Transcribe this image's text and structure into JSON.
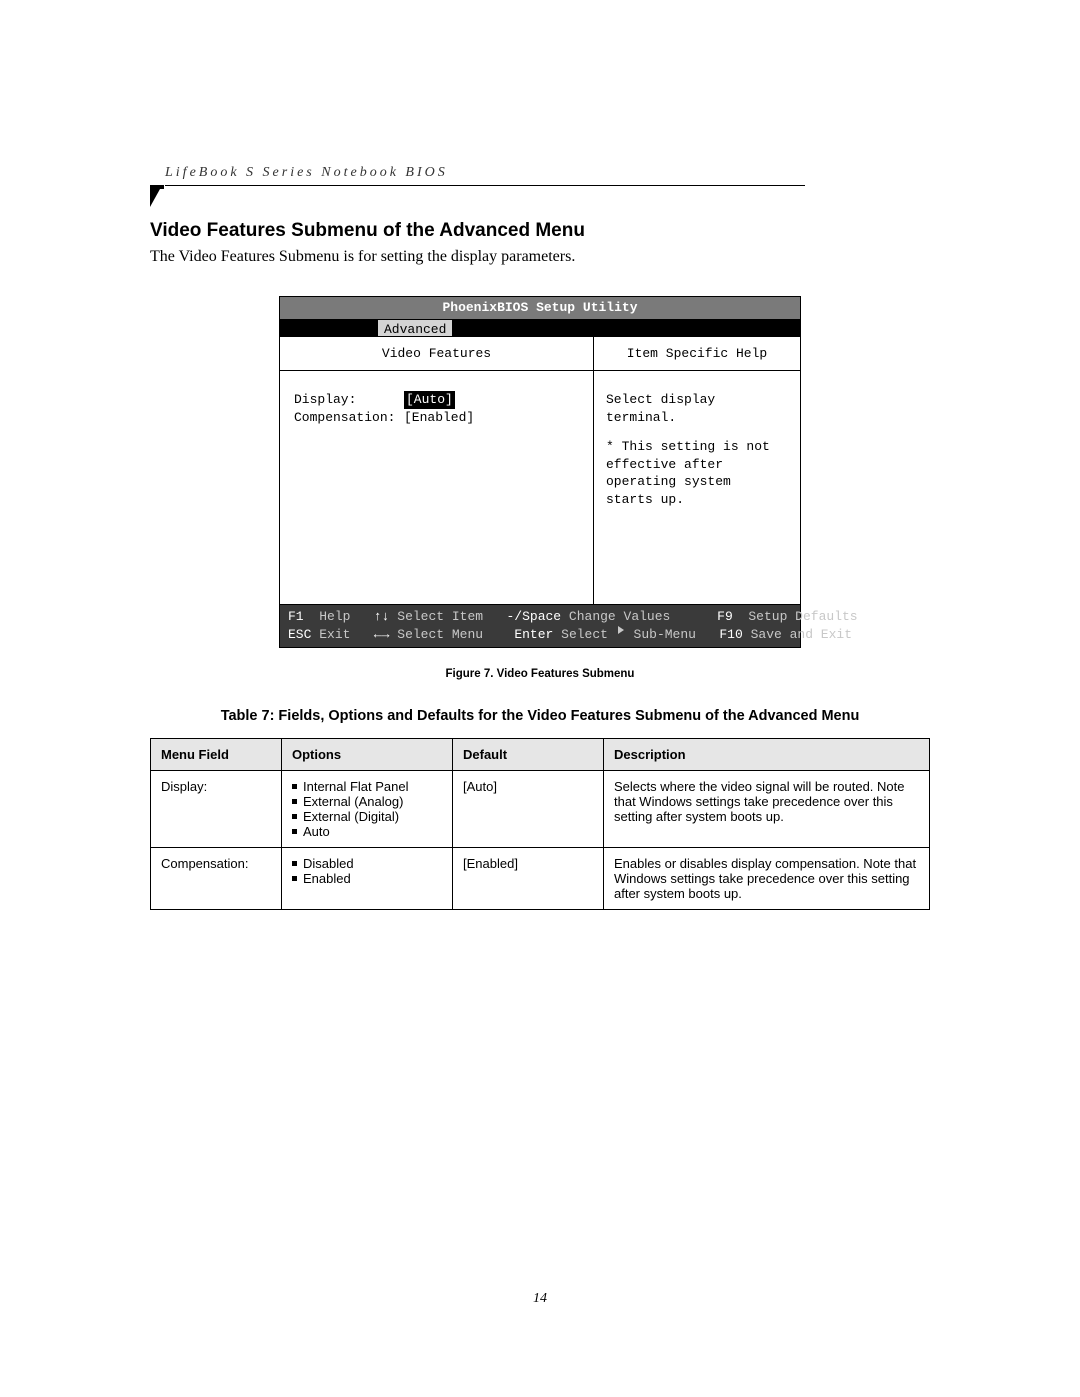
{
  "running_head": "LifeBook S Series Notebook BIOS",
  "page_number": "14",
  "section_title": "Video Features Submenu of the Advanced Menu",
  "intro_text": "The Video Features Submenu is for setting the display parameters.",
  "bios": {
    "title": "PhoenixBIOS Setup Utility",
    "tab": "Advanced",
    "left_col_title": "Video Features",
    "right_col_title": "Item Specific Help",
    "fields": {
      "display_label": "Display:",
      "display_value": "[Auto]",
      "compensation_label": "Compensation:",
      "compensation_value": "[Enabled]"
    },
    "help": {
      "line1": "Select display terminal.",
      "line2": "* This setting is not",
      "line3": "effective after",
      "line4": "operating system",
      "line5": "starts up."
    },
    "footer": {
      "f1_key": "F1",
      "f1_label": "Help",
      "updown_key": "↑↓",
      "updown_label": "Select Item",
      "minusspace_key": "-/Space",
      "minusspace_label": "Change Values",
      "f9_key": "F9",
      "f9_label": "Setup Defaults",
      "esc_key": "ESC",
      "esc_label": "Exit",
      "leftright_key": "←→",
      "leftright_label": "Select Menu",
      "enter_key": "Enter",
      "enter_label": "Select ▶ Sub-Menu",
      "f10_key": "F10",
      "f10_label": "Save and Exit"
    }
  },
  "figure_caption": "Figure 7.  Video Features Submenu",
  "table_title": "Table 7: Fields, Options and Defaults for the Video Features Submenu of the Advanced Menu",
  "table": {
    "headers": {
      "field": "Menu Field",
      "options": "Options",
      "def": "Default",
      "desc": "Description"
    },
    "rows": [
      {
        "field": "Display:",
        "options": [
          "Internal Flat Panel",
          "External (Analog)",
          "External (Digital)",
          "Auto"
        ],
        "def": "[Auto]",
        "desc": "Selects where the video signal will be routed. Note that Windows settings take precedence over this setting after system boots up."
      },
      {
        "field": "Compensation:",
        "options": [
          "Disabled",
          "Enabled"
        ],
        "def": "[Enabled]",
        "desc": "Enables or disables display compensation. Note that Windows settings take precedence over this setting after system boots up."
      }
    ]
  }
}
